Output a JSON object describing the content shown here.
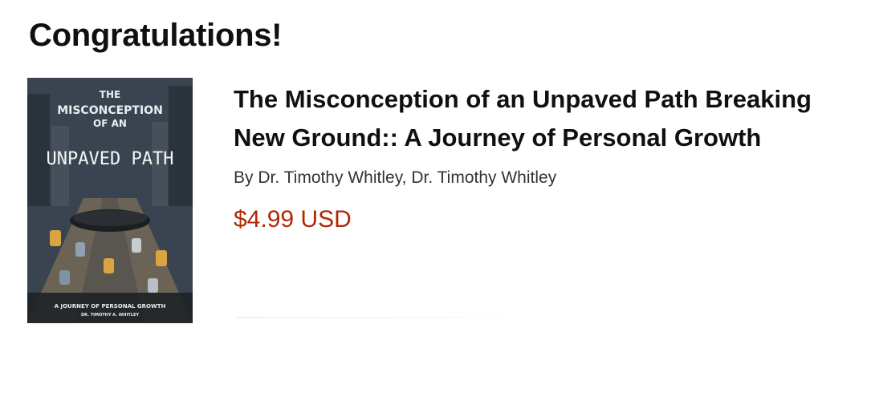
{
  "heading": "Congratulations!",
  "book": {
    "title": "The Misconception of an Unpaved Path Breaking New Ground:: A Journey of Personal Growth",
    "byline": "By Dr. Timothy Whitley, Dr. Timothy Whitley",
    "price": "$4.99 USD",
    "cover": {
      "line1": "THE",
      "line2": "MISCONCEPTION",
      "line3": "OF AN",
      "line4": "UNPAVED PATH",
      "subtitle": "A JOURNEY OF PERSONAL GROWTH",
      "author": "DR. TIMOTHY A. WHITLEY"
    }
  },
  "colors": {
    "price": "#b12704",
    "heading": "#0f1111"
  }
}
